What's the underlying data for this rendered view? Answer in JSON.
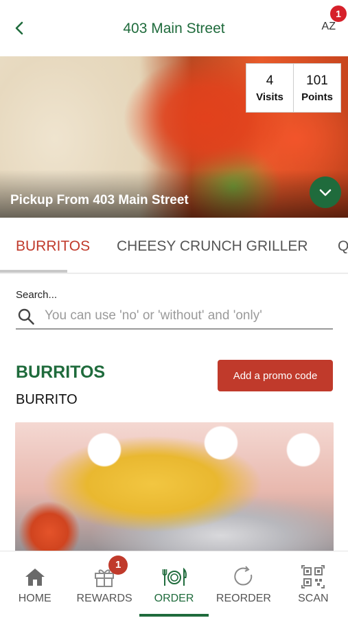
{
  "header": {
    "title": "403 Main Street",
    "avatar_initials": "AZ",
    "avatar_badge": "1"
  },
  "hero": {
    "title": "Pickup From 403 Main Street",
    "stats": [
      {
        "value": "4",
        "label": "Visits"
      },
      {
        "value": "101",
        "label": "Points"
      }
    ]
  },
  "tabs": [
    {
      "label": "BURRITOS"
    },
    {
      "label": "CHEESY CRUNCH GRILLER"
    },
    {
      "label": "Q"
    }
  ],
  "search": {
    "label": "Search...",
    "placeholder": "You can use 'no' or 'without' and 'only'"
  },
  "section": {
    "title": "BURRITOS",
    "promo_label": "Add a promo code",
    "subtitle": "BURRITO"
  },
  "nav": {
    "items": [
      {
        "label": "HOME",
        "icon": "home-icon"
      },
      {
        "label": "REWARDS",
        "icon": "gift-icon",
        "badge": "1"
      },
      {
        "label": "ORDER",
        "icon": "utensils-icon"
      },
      {
        "label": "REORDER",
        "icon": "reorder-icon"
      },
      {
        "label": "SCAN",
        "icon": "qr-code-icon"
      }
    ]
  },
  "colors": {
    "brand_green": "#1f6b3c",
    "accent_red": "#c03a2b",
    "badge_red": "#d6202a"
  }
}
